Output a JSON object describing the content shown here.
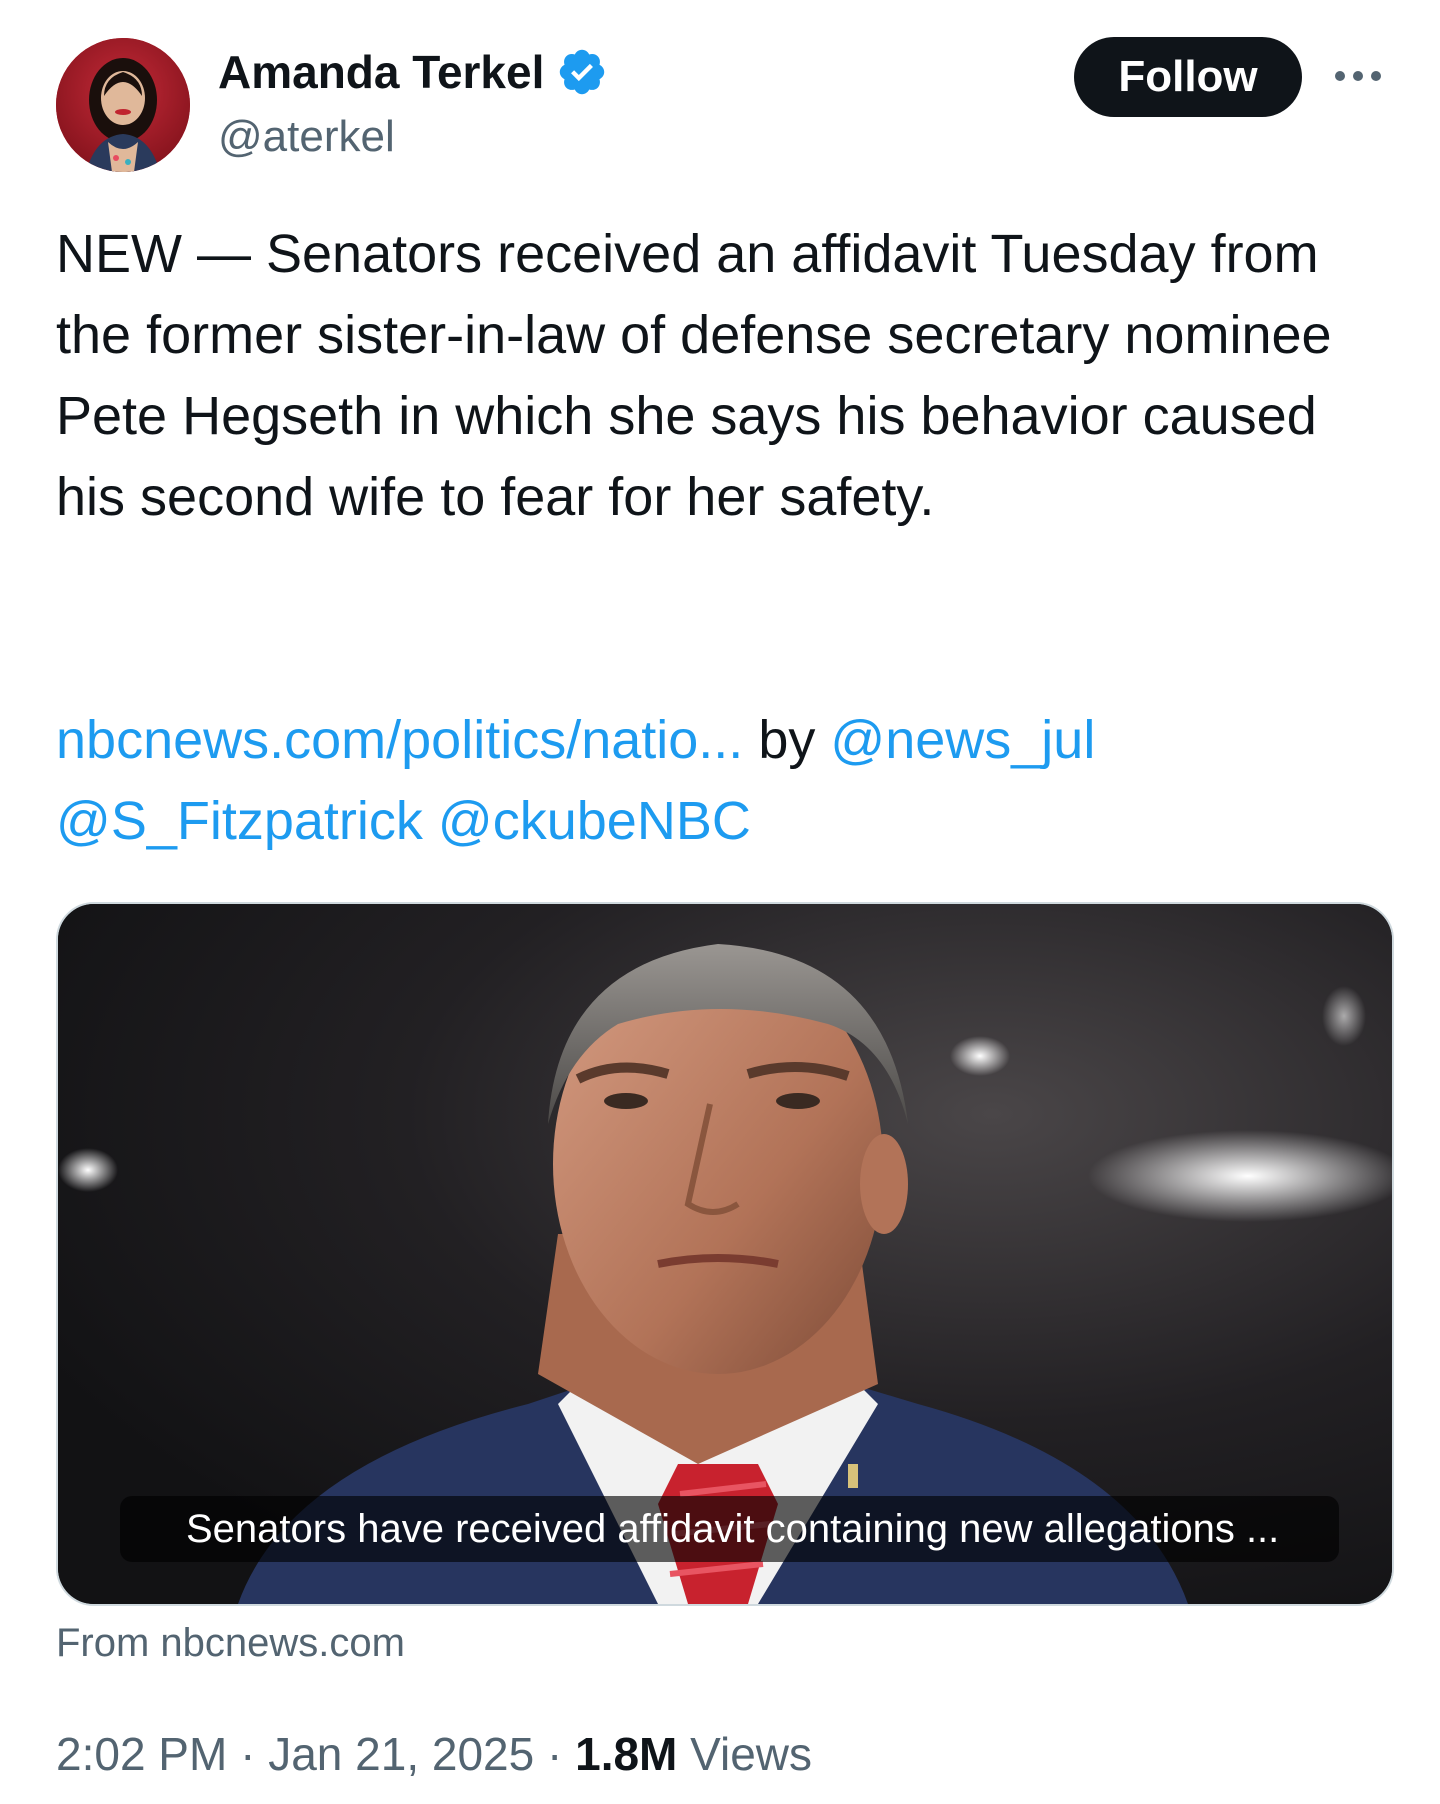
{
  "author": {
    "display_name": "Amanda Terkel",
    "handle": "@aterkel",
    "verified_icon": "verified-badge-icon",
    "avatar": "author-avatar"
  },
  "actions": {
    "follow_label": "Follow",
    "more_icon": "more-options-icon"
  },
  "tweet": {
    "text": "NEW — Senators received an affidavit Tuesday from the former sister-in-law of defense secretary nominee Pete Hegseth in which she says his behavior caused his second wife to fear for her safety.",
    "link_text": "nbcnews.com/politics/natio...",
    "by_text": " by ",
    "mention_1": "@news_jul",
    "mention_2": "@S_Fitzpatrick",
    "mention_3": "@ckubeNBC"
  },
  "link_card": {
    "caption": "Senators have received affidavit containing new allegations ...",
    "source": "From nbcnews.com"
  },
  "meta": {
    "time": "2:02 PM",
    "separator": " · ",
    "date": "Jan 21, 2025",
    "views_count": "1.8M",
    "views_label": " Views"
  },
  "colors": {
    "link": "#1d9bf0",
    "text": "#0f1419",
    "secondary": "#536471",
    "follow_bg": "#0f1419",
    "verified": "#1d9bf0"
  }
}
